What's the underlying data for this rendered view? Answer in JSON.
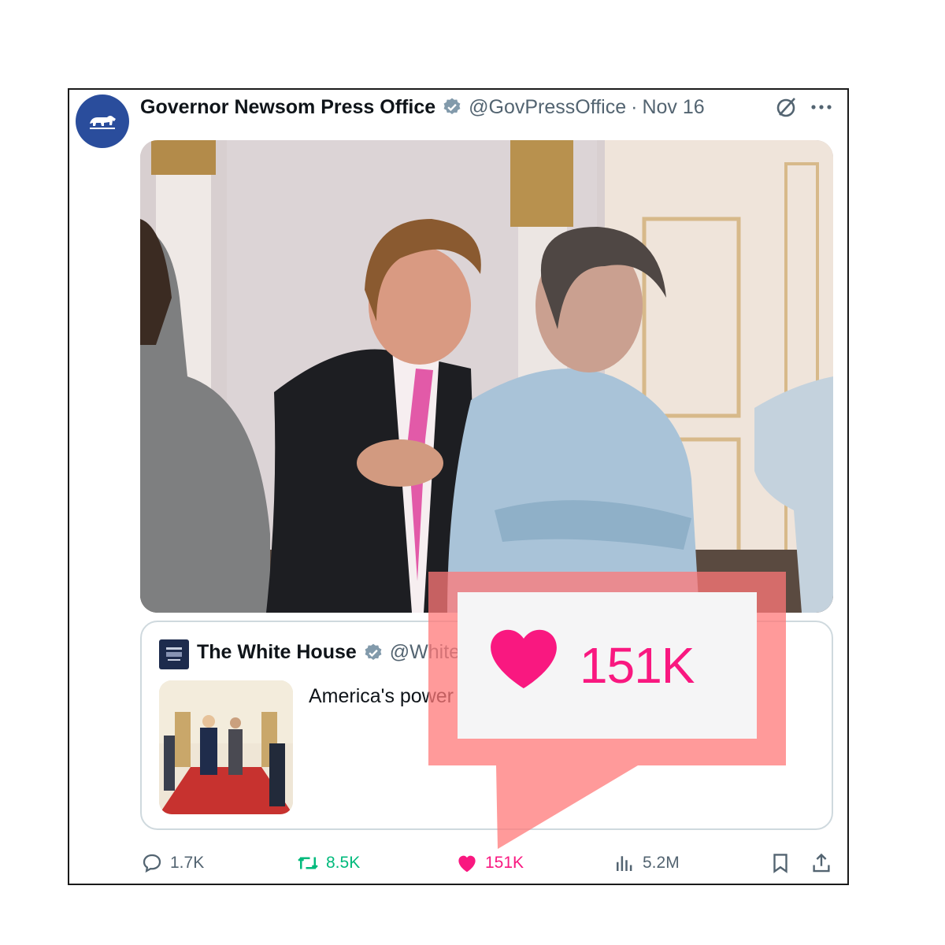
{
  "post": {
    "display_name": "Governor Newsom Press Office",
    "handle": "@GovPressOffice",
    "separator": "·",
    "date": "Nov 16"
  },
  "quoted_post": {
    "display_name": "The White House",
    "handle": "@White",
    "text": "America's power"
  },
  "actions": {
    "replies": "1.7K",
    "reposts": "8.5K",
    "likes": "151K",
    "views": "5.2M"
  },
  "callout": {
    "likes": "151K"
  },
  "colors": {
    "like": "#f91880",
    "repost": "#00ba7c",
    "muted": "#536471",
    "verified": "#829aab",
    "callout_band": "#ff7878"
  },
  "icons": [
    "california-bear-icon",
    "verified-badge-icon",
    "grok-icon",
    "more-icon",
    "reply-icon",
    "retweet-icon",
    "heart-icon",
    "views-icon",
    "bookmark-icon",
    "share-icon"
  ]
}
